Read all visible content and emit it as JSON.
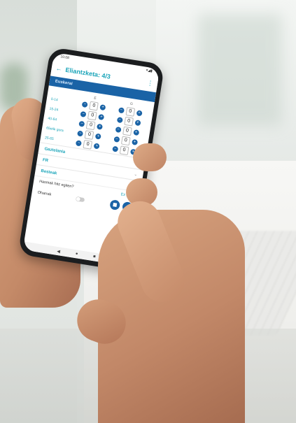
{
  "app": {
    "status_time": "10:08",
    "status_icons": "▾◢▮",
    "title": "Eliantzketa: 4/3",
    "tab": "Euskerai"
  },
  "grid": {
    "col_headers": [
      "E",
      "G"
    ],
    "rows": [
      {
        "label": "0-14",
        "values": [
          "0",
          "0"
        ]
      },
      {
        "label": "15-24",
        "values": [
          "0",
          "0"
        ]
      },
      {
        "label": "40-64",
        "values": [
          "0",
          "0"
        ]
      },
      {
        "label": "65etik gora",
        "values": [
          "0",
          "0"
        ]
      },
      {
        "label": "25-65",
        "values": [
          "0",
          "0"
        ]
      }
    ],
    "minus": "−",
    "plus": "+"
  },
  "sections": [
    {
      "label": "Gaztelania"
    },
    {
      "label": "FR"
    },
    {
      "label": "Besteak"
    }
  ],
  "question": {
    "text": "Hasmak hitz egiten?",
    "answer": "Ez / Bai"
  },
  "bottom_row": {
    "label": "Oharrak"
  },
  "fab": {
    "left": "◼",
    "right": "+"
  },
  "navbar": {
    "back": "◀",
    "home": "●",
    "recent": "■"
  },
  "icons": {
    "back": "arrow-left-icon",
    "more": "more-vertical-icon",
    "chevron": "chevron-down-icon"
  }
}
